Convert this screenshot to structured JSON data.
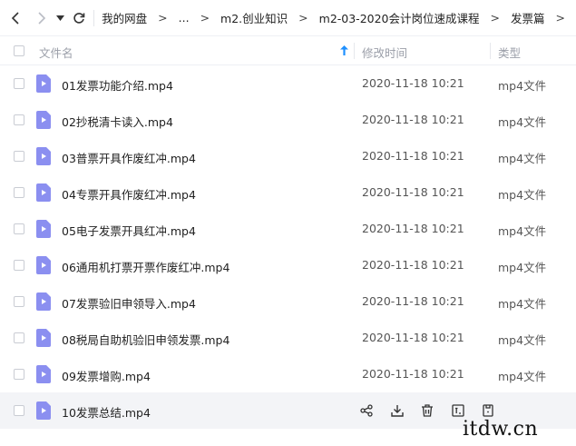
{
  "breadcrumb": [
    "我的网盘",
    "...",
    "m2.创业知识",
    "m2-03-2020会计岗位速成课程",
    "发票篇"
  ],
  "breadcrumb_sep": ">",
  "columns": {
    "name": "文件名",
    "modified": "修改时间",
    "type": "类型"
  },
  "files": [
    {
      "name": "01发票功能介绍.mp4",
      "modified": "2020-11-18 10:21",
      "type": "mp4文件"
    },
    {
      "name": "02抄税清卡读入.mp4",
      "modified": "2020-11-18 10:21",
      "type": "mp4文件"
    },
    {
      "name": "03普票开具作废红冲.mp4",
      "modified": "2020-11-18 10:21",
      "type": "mp4文件"
    },
    {
      "name": "04专票开具作废红冲.mp4",
      "modified": "2020-11-18 10:21",
      "type": "mp4文件"
    },
    {
      "name": "05电子发票开具红冲.mp4",
      "modified": "2020-11-18 10:21",
      "type": "mp4文件"
    },
    {
      "name": "06通用机打票开票作废红冲.mp4",
      "modified": "2020-11-18 10:21",
      "type": "mp4文件"
    },
    {
      "name": "07发票验旧申领导入.mp4",
      "modified": "2020-11-18 10:21",
      "type": "mp4文件"
    },
    {
      "name": "08税局自助机验旧申领发票.mp4",
      "modified": "2020-11-18 10:21",
      "type": "mp4文件"
    },
    {
      "name": "09发票增购.mp4",
      "modified": "2020-11-18 10:21",
      "type": "mp4文件"
    },
    {
      "name": "10发票总结.mp4",
      "modified": "",
      "type": ""
    }
  ],
  "hovered_row_index": 9,
  "row_actions": [
    "share-icon",
    "download-icon",
    "delete-icon",
    "rename-icon",
    "more-icon"
  ],
  "icons": {
    "back": "chevron-left-icon",
    "forward": "chevron-right-icon",
    "history": "caret-down-icon",
    "refresh": "refresh-icon",
    "sort": "sort-up-arrow-icon",
    "video": "video-file-icon"
  },
  "colors": {
    "accent": "#1e90ff",
    "video_icon": "#8b8ff0",
    "hover_row": "#f3f4f7"
  },
  "watermark": "itdw.cn"
}
